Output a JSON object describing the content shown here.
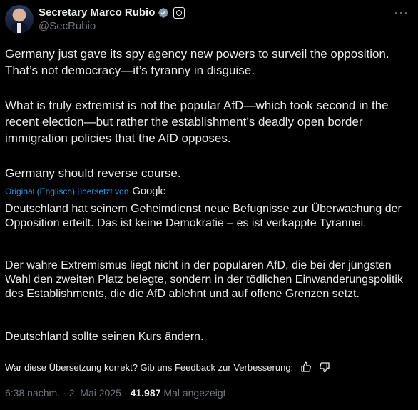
{
  "author": {
    "display_name": "Secretary Marco Rubio",
    "handle": "@SecRubio"
  },
  "tweet": {
    "paragraphs": [
      "Germany just gave its spy agency new powers to surveil the opposition. That’s not democracy—it’s tyranny in disguise.",
      "What is truly extremist is not the popular AfD—which took second in the recent election—but rather the establishment’s deadly open border immigration policies that the AfD opposes.",
      "Germany should reverse course."
    ]
  },
  "translation": {
    "attribution": "Original (Englisch) übersetzt von",
    "provider": "Google",
    "paragraphs": [
      "Deutschland hat seinem Geheimdienst neue Befugnisse zur Überwachung der Opposition erteilt. Das ist keine Demokratie – es ist verkappte Tyrannei.",
      "Der wahre Extremismus liegt nicht in der populären AfD, die bei der jüngsten Wahl den zweiten Platz belegte, sondern in der tödlichen Einwanderungspolitik des Establishments, die die AfD ablehnt und auf offene Grenzen setzt.",
      "Deutschland sollte seinen Kurs ändern."
    ],
    "feedback_prompt": "War diese Übersetzung korrekt? Gib uns Feedback zur Verbesserung:"
  },
  "meta": {
    "time": "6:38 nachm.",
    "separator": "·",
    "date": "2. Mai 2025",
    "views": "41.987",
    "views_label": "Mal angezeigt"
  },
  "icons": {
    "verified": "verified-badge-icon",
    "affiliation": "affiliation-seal-icon",
    "more": "more-options-icon",
    "thumbs_up": "thumbs-up-icon",
    "thumbs_down": "thumbs-down-icon"
  },
  "colors": {
    "background": "#000000",
    "text": "#e7e9ea",
    "muted": "#71767b",
    "link": "#1d9bf0",
    "verified": "#829aab"
  }
}
